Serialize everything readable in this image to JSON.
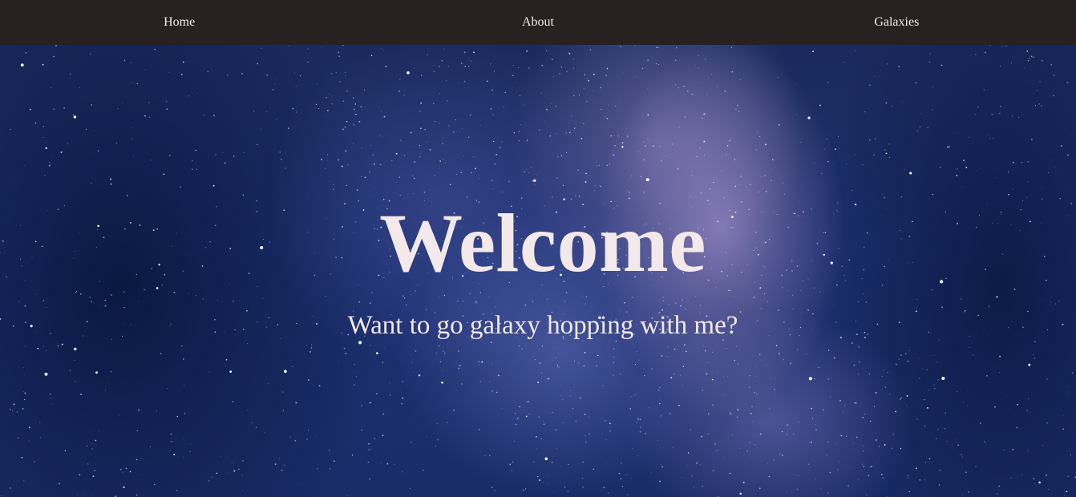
{
  "nav": {
    "items": [
      {
        "label": "Home"
      },
      {
        "label": "About"
      },
      {
        "label": "Galaxies"
      }
    ]
  },
  "hero": {
    "title": "Welcome",
    "subtitle": "Want to go galaxy hopping with me?"
  },
  "colors": {
    "navbar_bg": "#272120",
    "text": "#f3e9ea",
    "sky": "#1d3070"
  }
}
